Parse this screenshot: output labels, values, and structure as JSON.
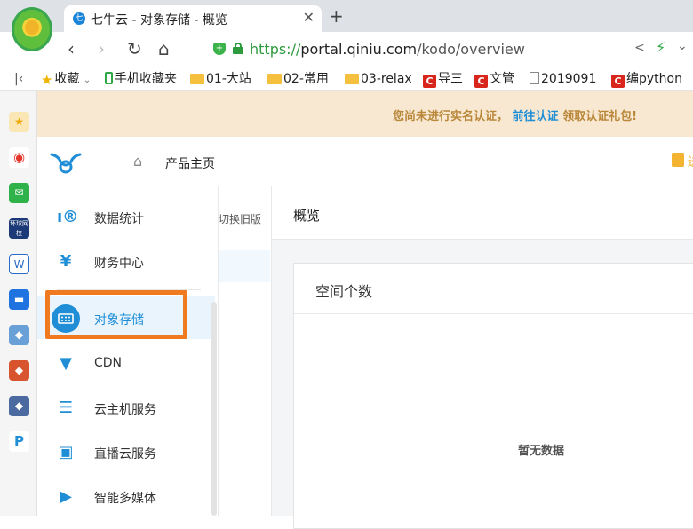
{
  "browser": {
    "tab_title": "七牛云 - 对象存储 - 概览",
    "url_scheme": "https://",
    "url_host": "portal.qiniu.com",
    "url_path": "/kodo/overview",
    "bookmarks": [
      {
        "label": "收藏",
        "icon": "star-icon"
      },
      {
        "label": "手机收藏夹",
        "icon": "phone-icon"
      },
      {
        "label": "01-大站",
        "icon": "folder-icon"
      },
      {
        "label": "02-常用",
        "icon": "folder-icon"
      },
      {
        "label": "03-relax",
        "icon": "folder-icon"
      },
      {
        "label": "导三",
        "icon": "csdn-icon"
      },
      {
        "label": "文管",
        "icon": "csdn-icon"
      },
      {
        "label": "2019091",
        "icon": "document-icon"
      },
      {
        "label": "编python",
        "icon": "csdn-icon"
      }
    ],
    "sidebar_badge": "环球网校"
  },
  "notice": {
    "text": "您尚未进行实名认证，",
    "link": "前往认证",
    "suffix": " 领取认证礼包!"
  },
  "topnav": {
    "home_label": "产品主页",
    "right_fragment": "送"
  },
  "menu": {
    "items": [
      {
        "label": "数据统计",
        "icon": "statistics-icon"
      },
      {
        "label": "财务中心",
        "icon": "yuan-icon"
      },
      {
        "label": "对象存储",
        "icon": "object-storage-icon",
        "active": true
      },
      {
        "label": "CDN",
        "icon": "cdn-icon"
      },
      {
        "label": "云主机服务",
        "icon": "cloud-host-icon"
      },
      {
        "label": "直播云服务",
        "icon": "live-stream-icon"
      },
      {
        "label": "智能多媒体",
        "icon": "multimedia-icon"
      }
    ]
  },
  "subpane": {
    "switch_label": "切换旧版"
  },
  "content": {
    "title": "概览",
    "card_title": "空间个数",
    "empty_text": "暂无数据"
  },
  "colors": {
    "brand": "#1f8ed6",
    "highlight": "#f07a20",
    "notice_bg": "#f8e8d1",
    "notice_text": "#b9873a"
  }
}
